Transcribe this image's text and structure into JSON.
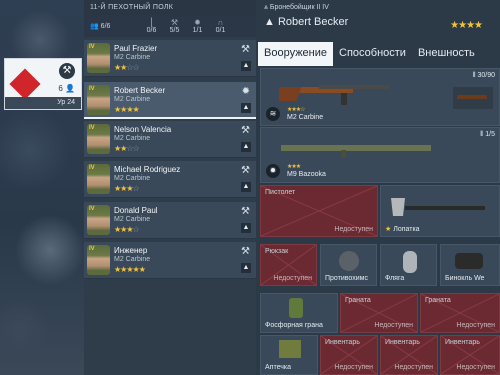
{
  "division": {
    "count": "6",
    "level": "Ур 24"
  },
  "squad": {
    "title": "11-Й ПЕХОТНЫЙ ПОЛК",
    "stats": [
      {
        "icon": "soldiers-icon",
        "value": "6/6"
      },
      {
        "icon": "rifle-icon",
        "value": "0/6"
      },
      {
        "icon": "wrench-icon",
        "value": "5/5"
      },
      {
        "icon": "explosion-icon",
        "value": "1/1"
      },
      {
        "icon": "headset-icon",
        "value": "0/1"
      }
    ],
    "rows": [
      {
        "name": "Paul Frazier",
        "weapon": "M2 Carbine",
        "stars": 2,
        "role_icon": "wrench-icon"
      },
      {
        "name": "Robert Becker",
        "weapon": "M2 Carbine",
        "stars": 4,
        "role_icon": "explosion-icon"
      },
      {
        "name": "Nelson Valencia",
        "weapon": "M2 Carbine",
        "stars": 2,
        "role_icon": "wrench-icon"
      },
      {
        "name": "Michael Rodriguez",
        "weapon": "M2 Carbine",
        "stars": 3,
        "role_icon": "wrench-icon"
      },
      {
        "name": "Donald Paul",
        "weapon": "M2 Carbine",
        "stars": 3,
        "role_icon": "wrench-icon"
      },
      {
        "name": "Инженер",
        "weapon": "M2 Carbine",
        "stars": 5,
        "role_icon": "wrench-icon"
      }
    ],
    "rank_label": "IV",
    "selected_index": 1
  },
  "soldier": {
    "class_label": "Бронебойщик II IV",
    "name": "Robert Becker",
    "stars": "★★★★"
  },
  "tabs": [
    "Вооружение",
    "Способности",
    "Внешность"
  ],
  "slots": {
    "primary": {
      "ammo": "30/90",
      "name": "M2 Carbine",
      "stars": "★★★☆"
    },
    "secondary": {
      "ammo": "1/5",
      "name": "M9 Bazooka",
      "stars": "★★★"
    },
    "pistol": {
      "label": "Пистолет",
      "status": "Недоступен"
    },
    "shovel": {
      "label": "Лопатка"
    },
    "backpack": {
      "label": "Рюкзак",
      "status": "Недоступен"
    },
    "item1": {
      "label": "Противохимс"
    },
    "item2": {
      "label": "Фляга"
    },
    "item3": {
      "label": "Бинокль We"
    },
    "grenade0": {
      "label": "Фосфорная грана"
    },
    "grenade1": {
      "label": "Граната",
      "status": "Недоступен"
    },
    "grenade2": {
      "label": "Граната",
      "status": "Недоступен"
    },
    "inv0": {
      "label": "Аптечка"
    },
    "inv1": {
      "label": "Инвентарь",
      "status": "Недоступен"
    },
    "inv2": {
      "label": "Инвентарь",
      "status": "Недоступен"
    },
    "inv3": {
      "label": "Инвентарь",
      "status": "Недоступен"
    }
  },
  "colors": {
    "accent_star": "#f2c33a",
    "unavailable": "#6b2a32",
    "panel": "#3a4959"
  }
}
